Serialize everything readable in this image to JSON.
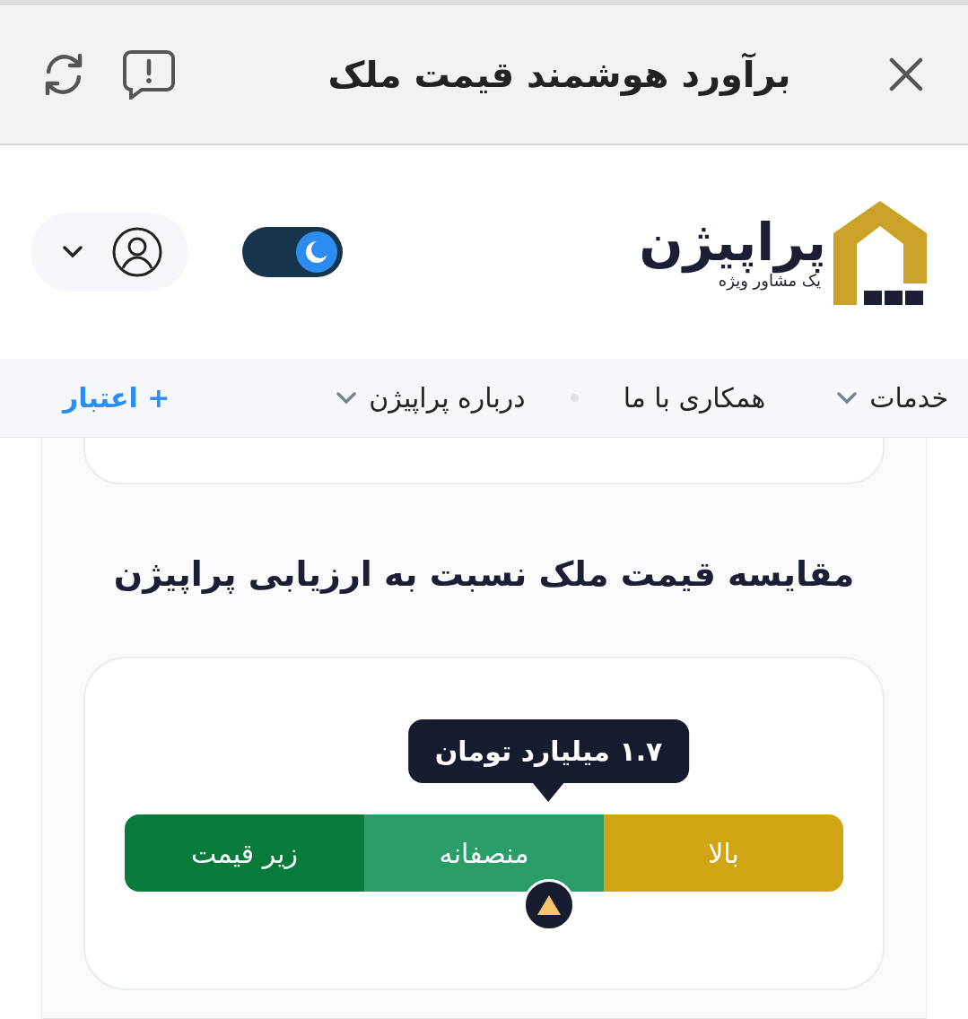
{
  "top_bar": {
    "title": "برآورد هوشمند قیمت ملک"
  },
  "header": {
    "logo": {
      "name": "پراپیژن",
      "tagline": "یک مشاور ویژه"
    },
    "dark_mode": {
      "on": true
    }
  },
  "nav": {
    "items": [
      {
        "label": "خدمات",
        "kind": "dropdown"
      },
      {
        "label": "همکاری با ما",
        "kind": "link"
      },
      {
        "kind": "dot"
      },
      {
        "label": "درباره پراپیژن",
        "kind": "dropdown"
      },
      {
        "label": "+ اعتبار",
        "kind": "accent"
      }
    ]
  },
  "comparison": {
    "title": "مقایسه قیمت ملک نسبت به ارزیابی پراپیژن",
    "tooltip": "۱.۷ میلیارد تومان",
    "level": 0.59,
    "segments": [
      {
        "label": "بالا",
        "color": "#d1a414"
      },
      {
        "label": "منصفانه",
        "color": "#2a9d69"
      },
      {
        "label": "زیر قیمت",
        "color": "#077a3c"
      }
    ]
  }
}
